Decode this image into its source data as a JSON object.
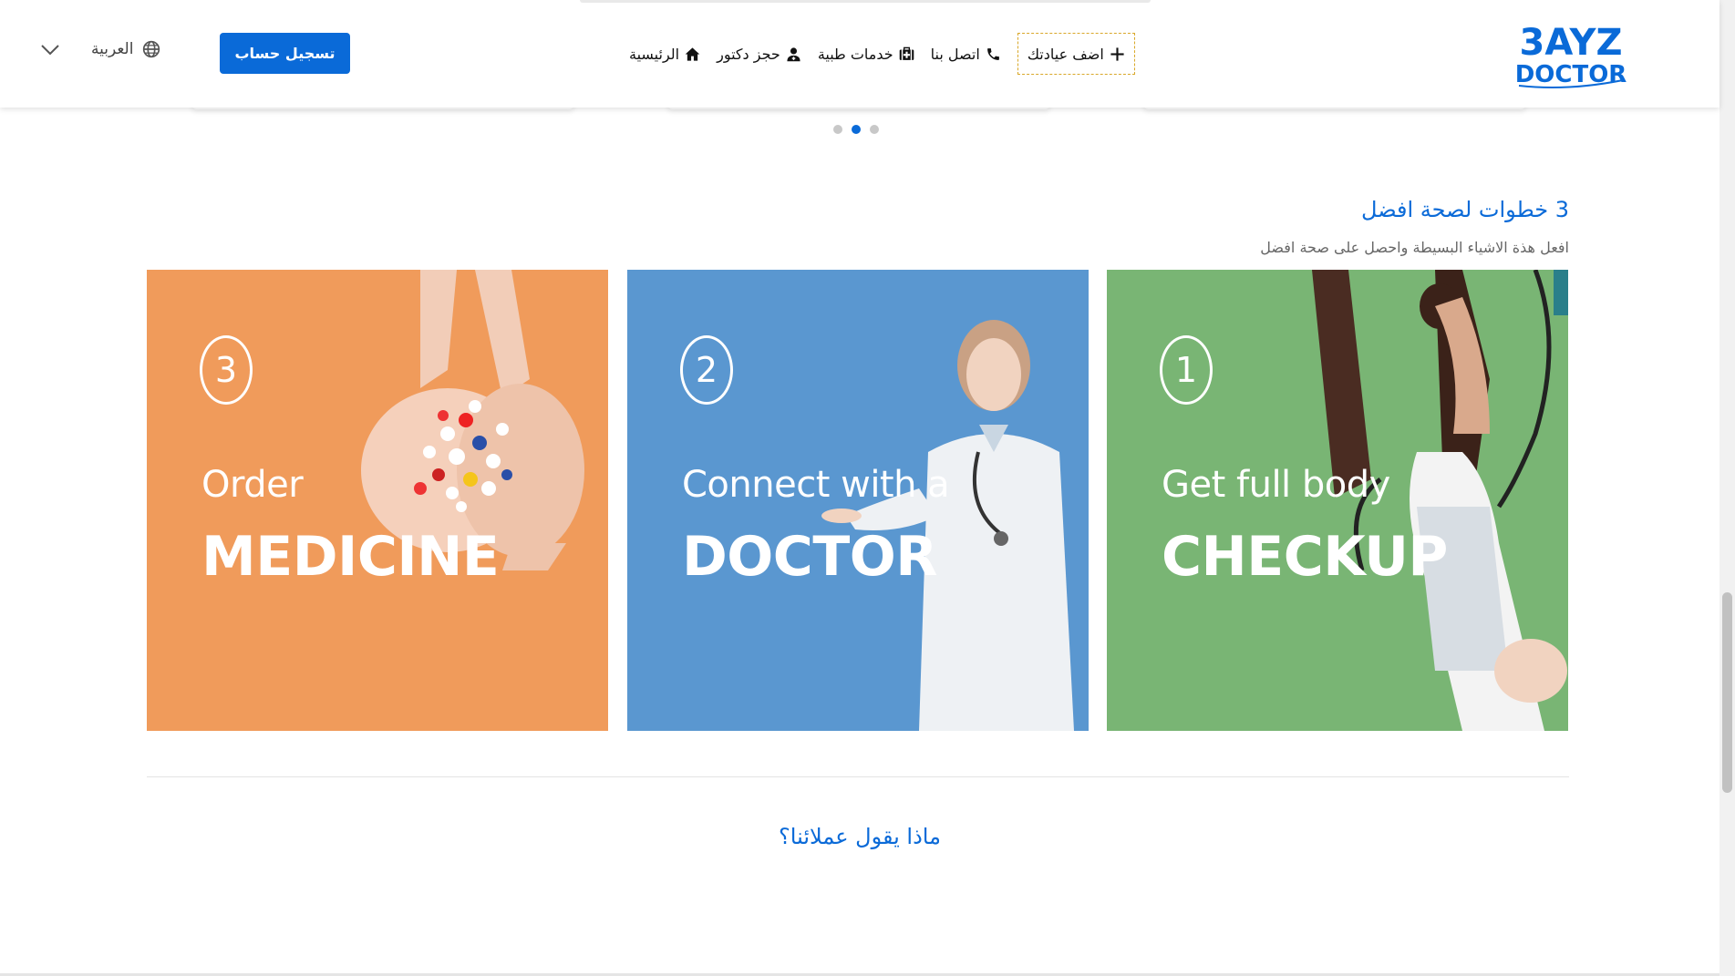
{
  "brand": {
    "logo_line1": "3AYZ",
    "logo_line2": "DOCTOR",
    "color": "#0a6ad8"
  },
  "nav": {
    "items": [
      {
        "label": "الرئيسية",
        "icon": "home-icon"
      },
      {
        "label": "حجز دكتور",
        "icon": "doctor-icon"
      },
      {
        "label": "خدمات طبية",
        "icon": "medical-kit-icon"
      },
      {
        "label": "اتصل بنا",
        "icon": "phone-icon"
      },
      {
        "label": "اضف عيادتك",
        "icon": "plus-icon"
      }
    ]
  },
  "header": {
    "register_label": "تسجيل حساب",
    "language_label": "العربية"
  },
  "carousel": {
    "active_dot": 1,
    "dot_count": 3
  },
  "steps_section": {
    "title": "3 خطوات لصحة افضل",
    "subtitle": "افعل هذة الاشياء البسيطة واحصل على صحة افضل",
    "cards": [
      {
        "number": "1",
        "line1": "Get full body",
        "line2": "CHECKUP",
        "bg": "#79b574"
      },
      {
        "number": "2",
        "line1": "Connect with a",
        "line2": "DOCTOR",
        "bg": "#5a97d0"
      },
      {
        "number": "3",
        "line1": "Order",
        "line2": "MEDICINE",
        "bg": "#f09b5b"
      }
    ]
  },
  "testimonials": {
    "title": "ماذا يقول عملائنا؟"
  }
}
